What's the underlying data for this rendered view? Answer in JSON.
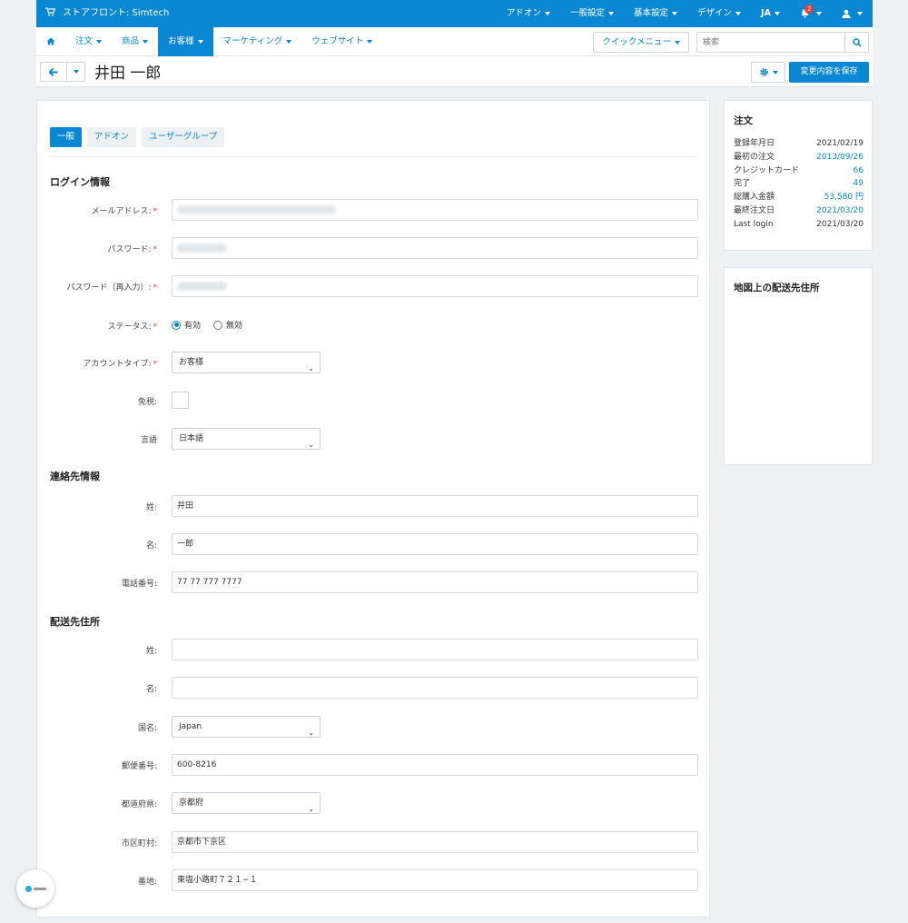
{
  "topbar": {
    "brand": "ストアフロント: Simtech",
    "menu": [
      "アドオン",
      "一般設定",
      "基本設定",
      "デザイン",
      "JA"
    ],
    "notification_count": "2"
  },
  "nav": {
    "items": [
      "注文",
      "商品",
      "お客様",
      "マーケティング",
      "ウェブサイト"
    ],
    "quick_menu": "クイックメニュー",
    "search_placeholder": "検索"
  },
  "page": {
    "title": "井田 一郎",
    "save_label": "変更内容を保存"
  },
  "tabs": [
    "一般",
    "アドオン",
    "ユーザーグループ"
  ],
  "login": {
    "section": "ログイン情報",
    "email_label": "メールアドレス:",
    "password_label": "パスワード:",
    "password2_label": "パスワード（再入力）:",
    "status_label": "ステータス:",
    "status_on": "有効",
    "status_off": "無効",
    "account_type_label": "アカウントタイプ:",
    "account_type_value": "お客様",
    "tax_exempt_label": "免税:",
    "language_label": "言語",
    "language_value": "日本語"
  },
  "contact": {
    "section": "連絡先情報",
    "lastname_label": "姓:",
    "lastname_value": "井田",
    "firstname_label": "名:",
    "firstname_value": "一郎",
    "phone_label": "電話番号:",
    "phone_value": "77 77 777 7777"
  },
  "shipping": {
    "section": "配送先住所",
    "lastname_label": "姓:",
    "lastname_value": "",
    "firstname_label": "名:",
    "firstname_value": "",
    "country_label": "国名:",
    "country_value": "Japan",
    "zip_label": "郵便番号:",
    "zip_value": "600-8216",
    "state_label": "都道府県:",
    "state_value": "京都府",
    "city_label": "市区町村:",
    "city_value": "京都市下京区",
    "address_label": "番地:",
    "address_value": "東塩小路町７２１−１"
  },
  "orders": {
    "title": "注文",
    "rows": [
      {
        "label": "登録年月日",
        "value": "2021/02/19"
      },
      {
        "label": "最初の注文",
        "value": "2013/09/26"
      },
      {
        "label": "クレジットカード",
        "value": "66"
      },
      {
        "label": "完了",
        "value": "49"
      },
      {
        "label": "総購入金額",
        "value": "53,580 円"
      },
      {
        "label": "最終注文日",
        "value": "2021/03/20"
      },
      {
        "label": "Last login",
        "value": "2021/03/20"
      }
    ]
  },
  "map": {
    "title": "地図上の配送先住所"
  },
  "colors": {
    "accent": "#0a87d2",
    "required": "#e03c3c"
  }
}
